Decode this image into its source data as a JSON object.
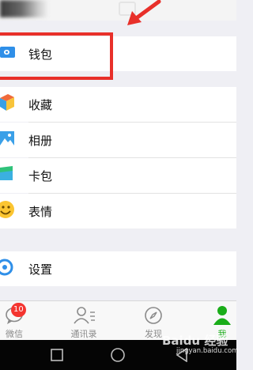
{
  "menu": {
    "wallet": "钱包",
    "favorites": "收藏",
    "album": "相册",
    "cards": "卡包",
    "stickers": "表情",
    "settings": "设置"
  },
  "tabs": [
    {
      "label": "微信",
      "badge": "10",
      "icon": "chat-bubble-icon"
    },
    {
      "label": "通讯录",
      "icon": "contacts-icon"
    },
    {
      "label": "发现",
      "icon": "compass-icon"
    },
    {
      "label": "我",
      "icon": "person-icon",
      "active": true
    }
  ],
  "watermark": {
    "brand": "Baidu 经验",
    "url": "jingyan.baidu.com"
  },
  "colors": {
    "accent_green": "#1aad19",
    "highlight_red": "#e8302a",
    "badge_red": "#f43530"
  }
}
